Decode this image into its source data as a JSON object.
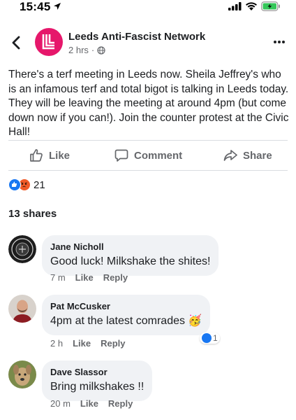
{
  "status_bar": {
    "time": "15:45"
  },
  "post": {
    "page_name": "Leeds Anti-Fascist Network",
    "time": "2 hrs",
    "separator": "·",
    "body": "There's a terf meeting in Leeds now. Sheila Jeffrey's who is an infamous terf and total bigot is talking in Leeds today. They will be leaving the meeting at around 4pm (but come down now if you can!). Join the counter protest at the Civic Hall!",
    "brand_color": "#e6176b"
  },
  "actions": {
    "like": "Like",
    "comment": "Comment",
    "share": "Share"
  },
  "reactions": {
    "count": "21",
    "types": [
      "like",
      "angry"
    ]
  },
  "shares": "13 shares",
  "comments": [
    {
      "author": "Jane Nicholl",
      "text": "Good luck! Milkshake the shites!",
      "time": "7 m",
      "like": "Like",
      "reply": "Reply"
    },
    {
      "author": "Pat McCusker",
      "text": "4pm at the latest comrades 🥳",
      "time": "2 h",
      "like": "Like",
      "reply": "Reply",
      "reaction_count": "1"
    },
    {
      "author": "Dave Slassor",
      "text": "Bring milkshakes !!",
      "time": "20 m",
      "like": "Like",
      "reply": "Reply"
    }
  ],
  "colors": {
    "facebook_blue": "#1877f2",
    "gray_text": "#65676b",
    "bubble_bg": "#f0f2f5"
  }
}
